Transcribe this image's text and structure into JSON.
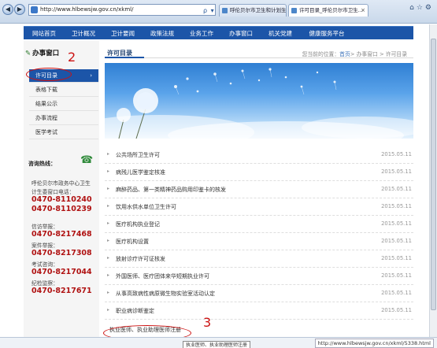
{
  "browser": {
    "url": "http://www.hlbewsjw.gov.cn/xkml/",
    "addr_tools": "ρ ▾ ⊠ C ×",
    "tabs": [
      {
        "label": "呼伦贝尔市卫生和计划生育委..."
      },
      {
        "label": "许可目录_呼伦贝尔市卫生..."
      }
    ],
    "status_url": "http://www.hlbewsjw.gov.cn/xkml/5338.html",
    "tooltip": "执业医师、执业助理医师注册"
  },
  "navbar": {
    "items": [
      "网站首页",
      "卫计概况",
      "卫计要闻",
      "政策法规",
      "业务工作",
      "办事窗口",
      "机关党建",
      "健康服务平台"
    ]
  },
  "sidebar": {
    "title": "办事窗口",
    "items": [
      {
        "label": "许可目录",
        "active": true
      },
      {
        "label": "表格下载"
      },
      {
        "label": "结果公示"
      },
      {
        "label": "办事流程"
      },
      {
        "label": "医学考试"
      }
    ],
    "hotline_label": "咨询热线：",
    "center_line1": "呼伦贝尔市政务中心卫生",
    "center_line2": "计生委窗口电话：",
    "center_phone1": "0470-8110240",
    "center_phone2": "0470-8110239",
    "letter_label": "信访举报：",
    "letter_phone": "0470-8217468",
    "supervise_label": "案件举报：",
    "supervise_phone": "0470-8217308",
    "exam_label": "考试咨询：",
    "exam_phone": "0470-8217044",
    "discipline_label": "纪检监察：",
    "discipline_phone": "0470-8217671"
  },
  "main": {
    "title": "许可目录",
    "breadcrumb_prefix": "您当前的位置：",
    "breadcrumb_home": "首页",
    "breadcrumb_rest": "> 办事窗口 > 许可目录",
    "rows": [
      {
        "title": "公共场所卫生许可",
        "date": "2015.05.11"
      },
      {
        "title": "病残儿医学鉴定核准",
        "date": "2015.05.11"
      },
      {
        "title": "麻醉药品、第一类精神药品购用印鉴卡的核发",
        "date": "2015.05.11"
      },
      {
        "title": "饮用水供水单位卫生许可",
        "date": "2015.05.11"
      },
      {
        "title": "医疗机构执业登记",
        "date": "2015.05.11"
      },
      {
        "title": "医疗机构设置",
        "date": "2015.05.11"
      },
      {
        "title": "放射诊疗许可证核发",
        "date": "2015.05.11"
      },
      {
        "title": "外国医师、医疗团体来华短期执业许可",
        "date": "2015.05.11"
      },
      {
        "title": "从事高致病性病原微生物实验室活动认定",
        "date": "2015.05.11"
      },
      {
        "title": "职业病诊断鉴定",
        "date": "2015.05.11"
      },
      {
        "title": "执业医师、执业助理医师注册",
        "date": ""
      }
    ]
  },
  "annotations": {
    "num2": "2",
    "num3": "3"
  },
  "colors": {
    "brand": "#1c55a8",
    "phone": "#b01212",
    "annotation": "#cc1111"
  }
}
